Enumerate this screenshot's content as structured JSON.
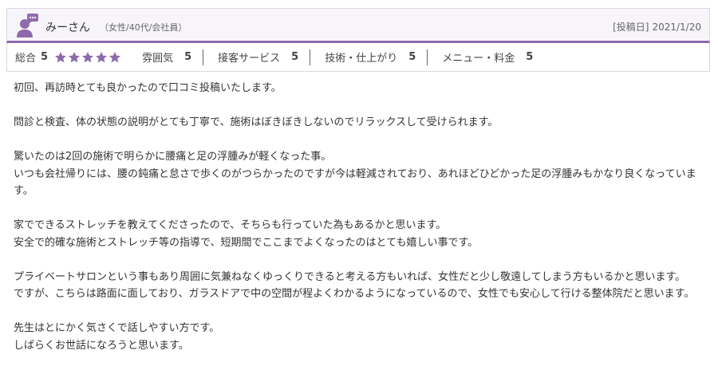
{
  "reviewer": {
    "name": "みーさん",
    "meta": "（女性/40代/会社員）",
    "date_label": "[投稿日]",
    "date": "2021/1/20"
  },
  "ratings": {
    "overall_label": "総合",
    "overall_score": "5",
    "star_count": 5,
    "star_color": "#8e6aad",
    "categories": [
      {
        "label": "雰囲気",
        "score": "5"
      },
      {
        "label": "接客サービス",
        "score": "5"
      },
      {
        "label": "技術・仕上がり",
        "score": "5"
      },
      {
        "label": "メニュー・料金",
        "score": "5"
      }
    ]
  },
  "body": {
    "paragraphs": [
      [
        "初回、再訪時とても良かったので口コミ投稿いたします。"
      ],
      [
        "問診と検査、体の状態の説明がとても丁寧で、施術はぼきぼきしないのでリラックスして受けられます。"
      ],
      [
        "驚いたのは2回の施術で明らかに腰痛と足の浮腫みが軽くなった事。",
        "いつも会社帰りには、腰の鈍痛と怠さで歩くのがつらかったのですが今は軽減されており、あれほどひどかった足の浮腫みもかなり良くなっています。"
      ],
      [
        "家でできるストレッチを教えてくださったので、そちらも行っていた為もあるかと思います。",
        "安全で的確な施術とストレッチ等の指導で、短期間でここまでよくなったのはとても嬉しい事です。"
      ],
      [
        "プライベートサロンという事もあり周囲に気兼ねなくゆっくりできると考える方もいれば、女性だと少し敬遠してしまう方もいるかと思います。",
        "ですが、こちらは路面に面しており、ガラスドアで中の空間が程よくわかるようになっているので、女性でも安心して行ける整体院だと思います。"
      ],
      [
        "先生はとにかく気さくで話しやすい方です。",
        "しばらくお世話になろうと思います。"
      ]
    ]
  },
  "colors": {
    "accent": "#8e6aad",
    "header_bg": "#f7f5f9"
  }
}
